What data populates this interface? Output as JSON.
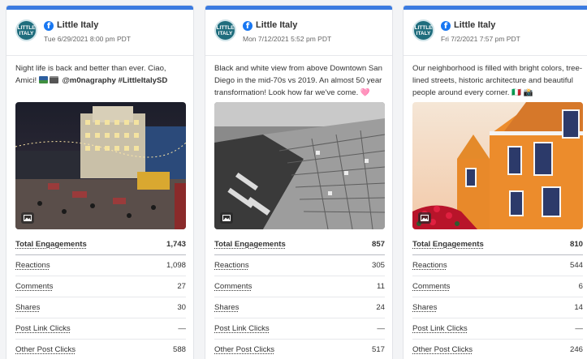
{
  "posts": [
    {
      "page_name": "Little Italy",
      "avatar_text": [
        "LITTLE",
        "ITALY"
      ],
      "date": "Tue 6/29/2021 8:00 pm PDT",
      "caption": "Night life is back and better than ever. Ciao, Amici! 🗾 📸 @m0nagraphy #LittleItalySD",
      "caption_parts": [
        "Night life is back and better than ever. Ciao, Amici! ",
        " @m0nagraphy #LittleItalySD"
      ],
      "metrics": [
        {
          "label": "Total Engagements",
          "value": "1,743"
        },
        {
          "label": "Reactions",
          "value": "1,098"
        },
        {
          "label": "Comments",
          "value": "27"
        },
        {
          "label": "Shares",
          "value": "30"
        },
        {
          "label": "Post Link Clicks",
          "value": "—"
        },
        {
          "label": "Other Post Clicks",
          "value": "588"
        }
      ]
    },
    {
      "page_name": "Little Italy",
      "avatar_text": [
        "LITTLE",
        "ITALY"
      ],
      "date": "Mon 7/12/2021 5:52 pm PDT",
      "caption": "Black and white view from above Downtown San Diego in the mid-70s vs 2019. An almost 50 year transformation! Look how far we've come. 🩷",
      "metrics": [
        {
          "label": "Total Engagements",
          "value": "857"
        },
        {
          "label": "Reactions",
          "value": "305"
        },
        {
          "label": "Comments",
          "value": "11"
        },
        {
          "label": "Shares",
          "value": "24"
        },
        {
          "label": "Post Link Clicks",
          "value": "—"
        },
        {
          "label": "Other Post Clicks",
          "value": "517"
        }
      ]
    },
    {
      "page_name": "Little Italy",
      "avatar_text": [
        "LITTLE",
        "ITALY"
      ],
      "date": "Fri 7/2/2021 7:57 pm PDT",
      "caption": "Our neighborhood is filled with bright colors, tree-lined streets, historic architecture and beautiful people around every corner. 🇮🇹 📸",
      "metrics": [
        {
          "label": "Total Engagements",
          "value": "810"
        },
        {
          "label": "Reactions",
          "value": "544"
        },
        {
          "label": "Comments",
          "value": "6"
        },
        {
          "label": "Shares",
          "value": "14"
        },
        {
          "label": "Post Link Clicks",
          "value": "—"
        },
        {
          "label": "Other Post Clicks",
          "value": "246"
        }
      ]
    }
  ],
  "colors": {
    "accent_bar": "#3b7be0",
    "facebook": "#1877f2",
    "avatar_bg": "#1f6d7d"
  },
  "icons": {
    "platform": "facebook-icon",
    "media": "image-icon"
  }
}
